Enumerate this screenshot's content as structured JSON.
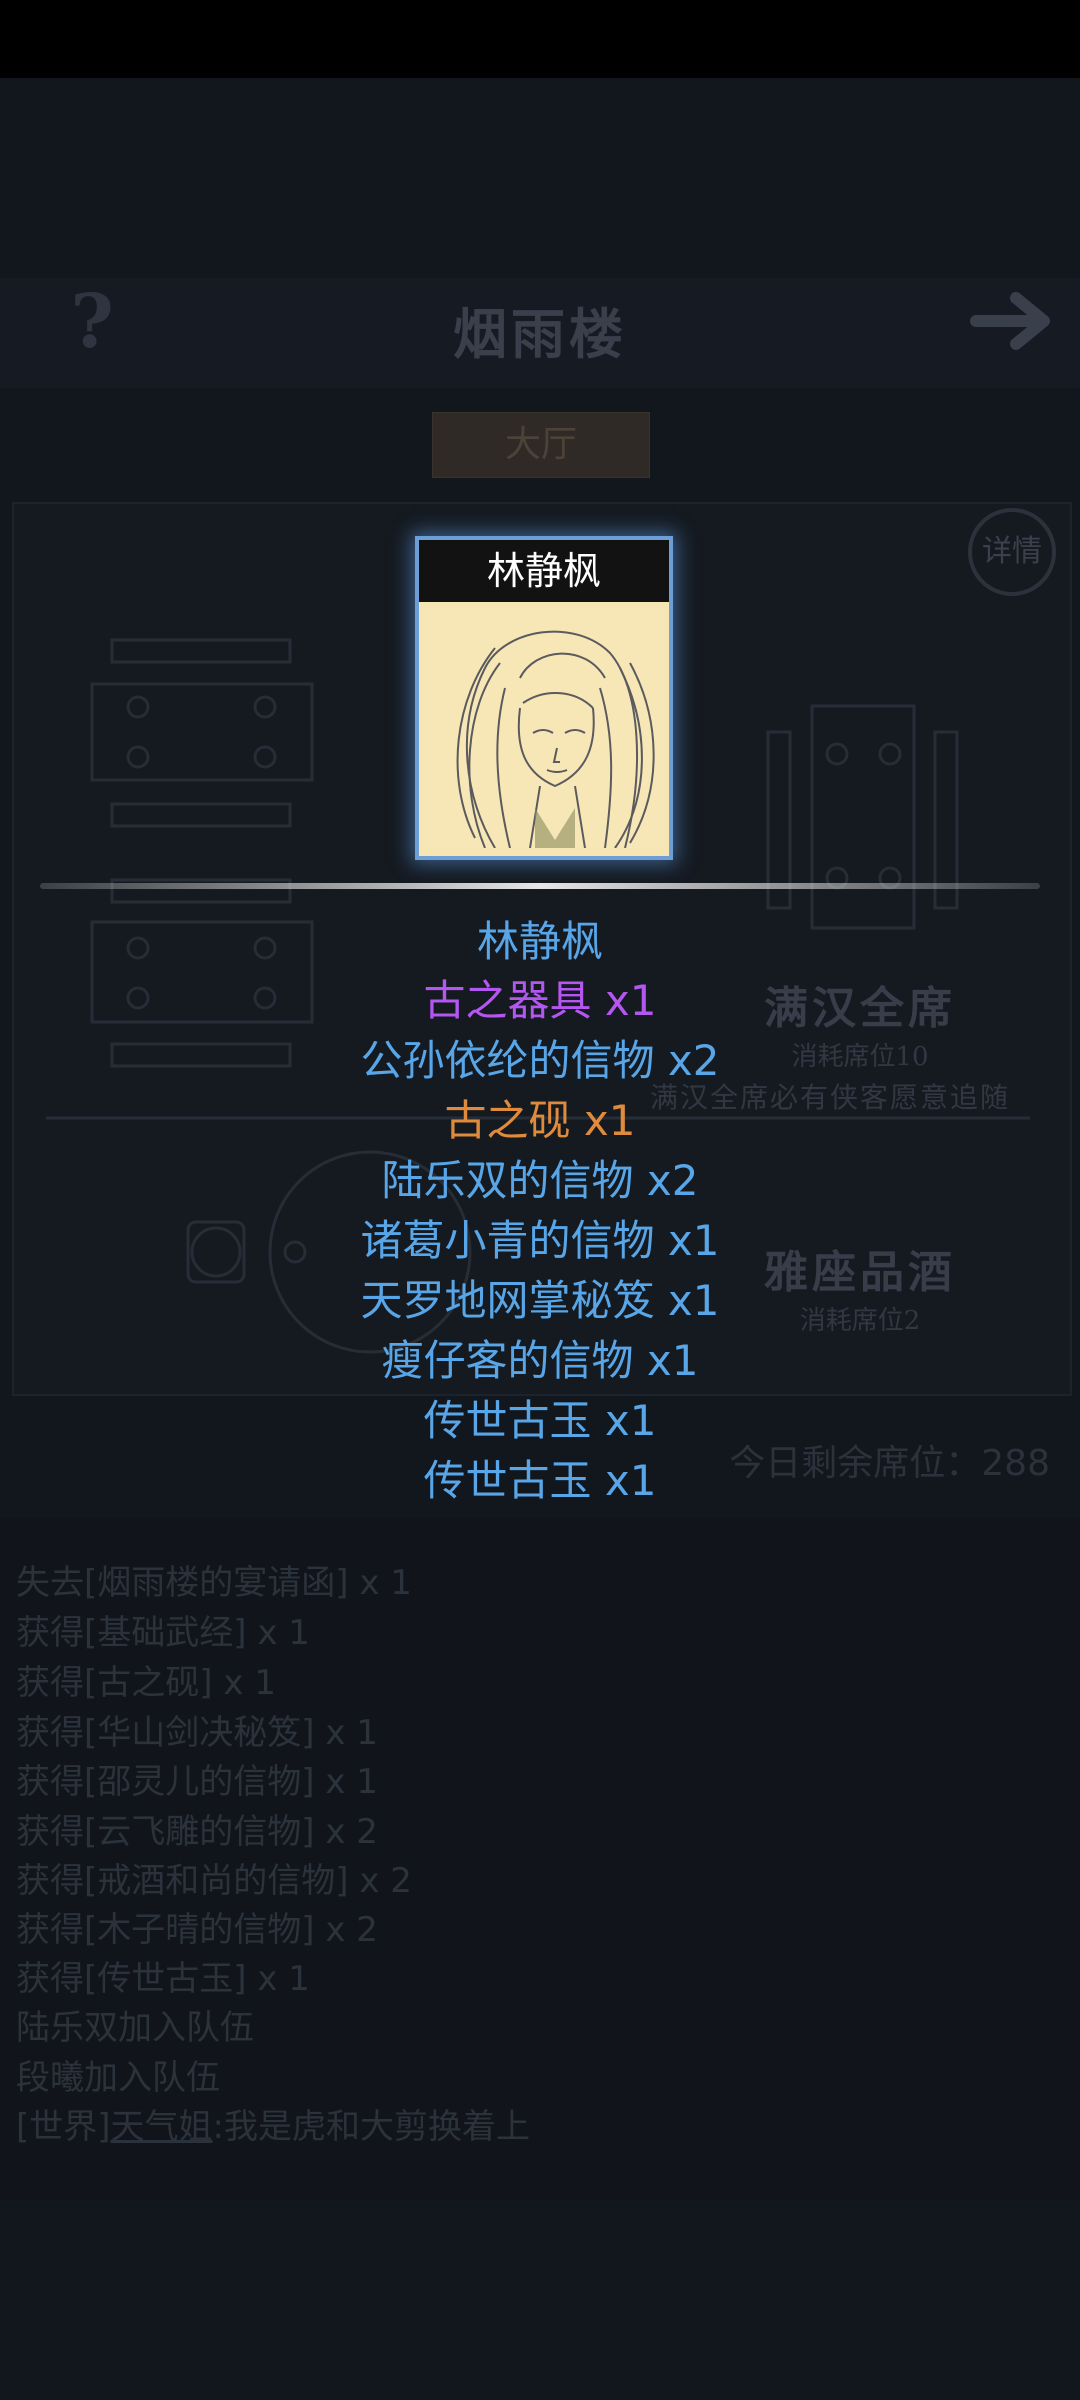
{
  "screen": {
    "title": "烟雨楼",
    "tab": "大厅",
    "detail_label": "详情",
    "help_icon": "question-mark-icon",
    "next_icon": "arrow-right-icon",
    "seats": [
      {
        "title": "满汉全席",
        "cost": "消耗席位10",
        "note": "满汉全席必有侠客愿意追随"
      },
      {
        "title": "雅座品酒",
        "cost": "消耗席位2"
      }
    ],
    "seats_remaining": "今日剩余席位：288"
  },
  "log": [
    "失去[烟雨楼的宴请函] x 1",
    "获得[基础武经] x 1",
    "获得[古之砚] x 1",
    "获得[华山剑决秘笈] x 1",
    "获得[邵灵儿的信物] x 1",
    "获得[云飞雕的信物] x 2",
    "获得[戒酒和尚的信物] x 2",
    "获得[木子晴的信物] x 2",
    "获得[传世古玉] x 1",
    "陆乐双加入队伍",
    "段曦加入队伍"
  ],
  "world_chat": {
    "tag": "[世界]",
    "user": "天气姐",
    "message": ":我是虎和大剪换着上"
  },
  "popup": {
    "hero_name": "林静枫",
    "rewards": [
      {
        "text": "林静枫",
        "color": "#58a6e8"
      },
      {
        "text": "古之器具 x1",
        "color": "#b456f0"
      },
      {
        "text": "公孙依纶的信物 x2",
        "color": "#58a6e8"
      },
      {
        "text": "古之砚 x1",
        "color": "#e08b3c"
      },
      {
        "text": "陆乐双的信物 x2",
        "color": "#58a6e8"
      },
      {
        "text": "诸葛小青的信物 x1",
        "color": "#58a6e8"
      },
      {
        "text": "天罗地网掌秘笈 x1",
        "color": "#58a6e8"
      },
      {
        "text": "瘦仔客的信物 x1",
        "color": "#58a6e8"
      },
      {
        "text": "传世古玉 x1",
        "color": "#58a6e8"
      },
      {
        "text": "传世古玉 x1",
        "color": "#58a6e8"
      }
    ]
  }
}
